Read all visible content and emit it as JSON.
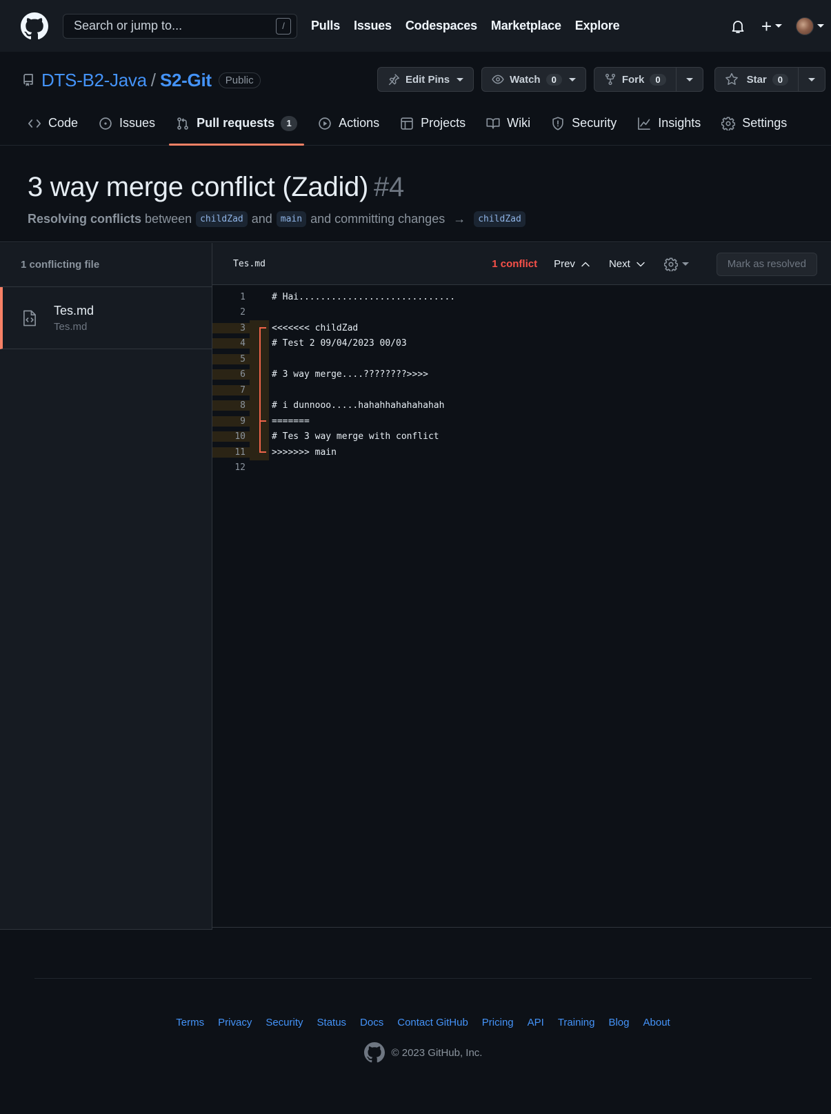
{
  "header": {
    "search_placeholder": "Search or jump to...",
    "search_shortcut": "/",
    "nav": [
      "Pulls",
      "Issues",
      "Codespaces",
      "Marketplace",
      "Explore"
    ],
    "plus_label": "+"
  },
  "repo": {
    "owner": "DTS-B2-Java",
    "separator": "/",
    "name": "S2-Git",
    "visibility": "Public",
    "edit_pins_label": "Edit Pins",
    "watch_label": "Watch",
    "watch_count": "0",
    "fork_label": "Fork",
    "fork_count": "0",
    "star_label": "Star",
    "star_count": "0"
  },
  "tabs": [
    {
      "label": "Code",
      "icon": "code-icon"
    },
    {
      "label": "Issues",
      "icon": "issue-opened-icon"
    },
    {
      "label": "Pull requests",
      "icon": "git-pull-request-icon",
      "count": "1",
      "active": true
    },
    {
      "label": "Actions",
      "icon": "play-icon"
    },
    {
      "label": "Projects",
      "icon": "table-icon"
    },
    {
      "label": "Wiki",
      "icon": "book-icon"
    },
    {
      "label": "Security",
      "icon": "shield-icon"
    },
    {
      "label": "Insights",
      "icon": "graph-icon"
    },
    {
      "label": "Settings",
      "icon": "gear-icon"
    }
  ],
  "pr": {
    "title": "3 way merge conflict (Zadid)",
    "number": "#4",
    "sub_strong": "Resolving conflicts",
    "sub_between": "between",
    "branch_a": "childZad",
    "sub_and": "and",
    "branch_b": "main",
    "sub_committing": "and committing changes",
    "arrow": "→",
    "target_branch": "childZad"
  },
  "sidebar": {
    "heading": "1 conflicting file",
    "files": [
      {
        "name": "Tes.md",
        "path": "Tes.md"
      }
    ]
  },
  "editor": {
    "filename": "Tes.md",
    "conflict_count": "1 conflict",
    "prev_label": "Prev",
    "next_label": "Next",
    "resolve_label": "Mark as resolved",
    "lines": [
      {
        "n": "1",
        "text": "# Hai.............................",
        "conflict": ""
      },
      {
        "n": "2",
        "text": "",
        "conflict": ""
      },
      {
        "n": "3",
        "text": "<<<<<<< childZad",
        "conflict": "start"
      },
      {
        "n": "4",
        "text": "# Test 2 09/04/2023 00/03",
        "conflict": "in"
      },
      {
        "n": "5",
        "text": "",
        "conflict": "in"
      },
      {
        "n": "6",
        "text": "# 3 way merge....????????>>>>",
        "conflict": "in"
      },
      {
        "n": "7",
        "text": "",
        "conflict": "in"
      },
      {
        "n": "8",
        "text": "# i dunnooo.....hahahhahahahahah",
        "conflict": "in"
      },
      {
        "n": "9",
        "text": "=======",
        "conflict": "mid"
      },
      {
        "n": "10",
        "text": "# Tes 3 way merge with conflict",
        "conflict": "in"
      },
      {
        "n": "11",
        "text": ">>>>>>> main",
        "conflict": "end"
      },
      {
        "n": "12",
        "text": "",
        "conflict": ""
      }
    ]
  },
  "footer": {
    "links": [
      "Terms",
      "Privacy",
      "Security",
      "Status",
      "Docs",
      "Contact GitHub",
      "Pricing",
      "API",
      "Training",
      "Blog",
      "About"
    ],
    "copyright": "© 2023 GitHub, Inc."
  },
  "colors": {
    "accent_tab": "#f78166",
    "link": "#4493f8",
    "conflict_red": "#f85149",
    "background": "#0d1117"
  }
}
